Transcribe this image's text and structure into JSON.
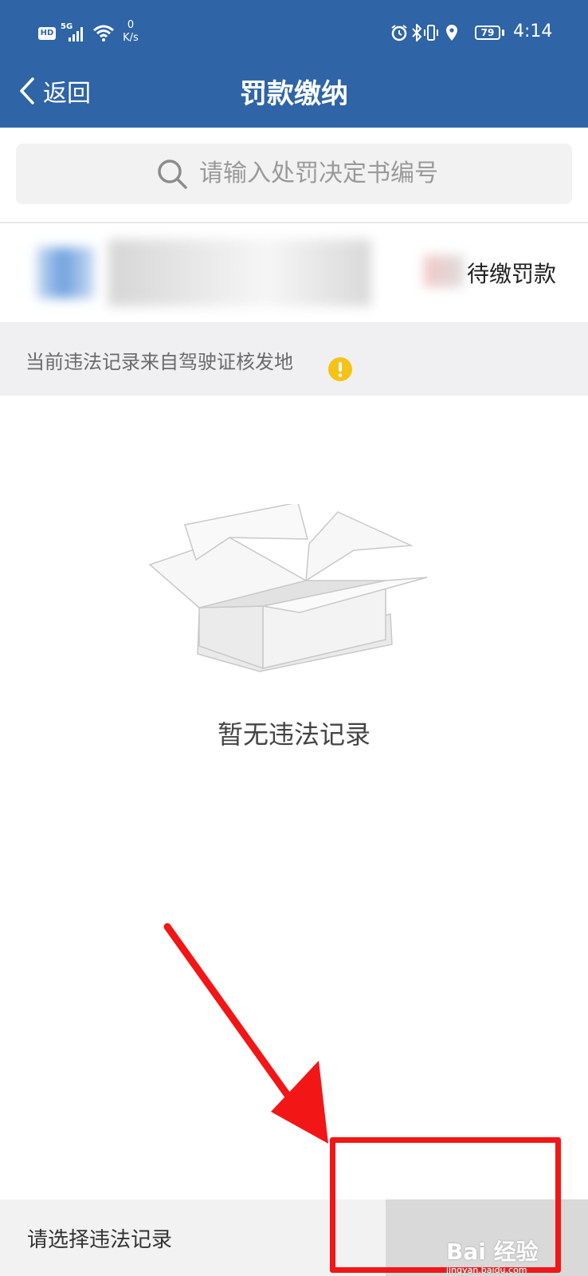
{
  "status_bar": {
    "hd": "HD",
    "network_generation": "5G",
    "speed_value": "0",
    "speed_unit": "K/s",
    "battery_level": "79",
    "time": "4:14",
    "icons": [
      "alarm-icon",
      "bluetooth-icon",
      "vibrate-icon",
      "location-icon"
    ]
  },
  "header": {
    "back_label": "返回",
    "title": "罚款缴纳",
    "background_color": "#2f64a6"
  },
  "search": {
    "placeholder": "请输入处罚决定书编号"
  },
  "plate_row": {
    "status_text": "待缴罚款"
  },
  "notice": {
    "text": "当前违法记录来自驾驶证核发地",
    "icon": "warning-icon",
    "icon_color": "#f5c218"
  },
  "empty_state": {
    "icon": "empty-box-icon",
    "text": "暂无违法记录"
  },
  "bottom_bar": {
    "select_prompt": "请选择违法记录"
  },
  "annotation": {
    "arrow_color": "#f21616"
  },
  "watermark": {
    "brand": "Bai 经验",
    "url": "jingyan.baidu.com"
  }
}
